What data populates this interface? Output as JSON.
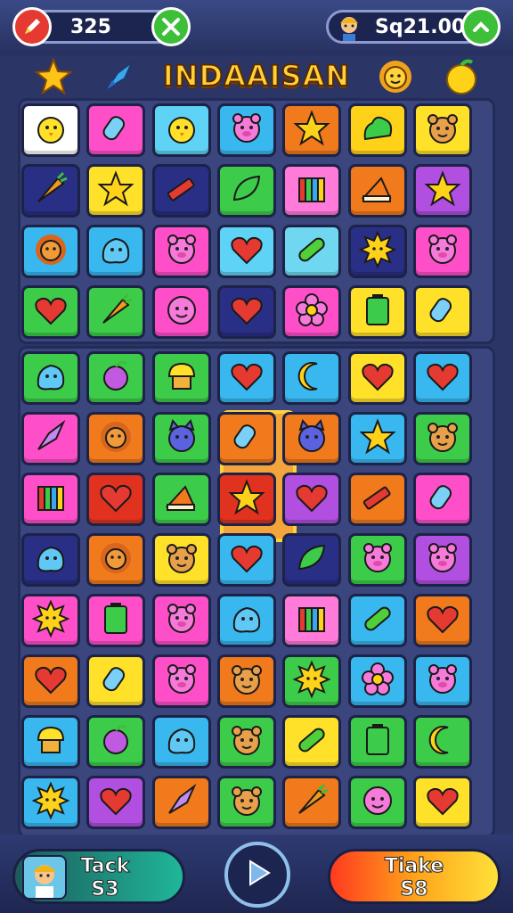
{
  "hud": {
    "score": "325",
    "currency": "Sq21.00",
    "score_icon": "pencil-icon",
    "tools_icon": "tools-icon",
    "up_icon": "chevron-up-icon",
    "avatar_icon": "character-avatar-icon"
  },
  "header": {
    "title": "INDAAISAN",
    "left_icons": [
      "star-icon",
      "rocket-icon"
    ],
    "right_icons": [
      "lion-icon",
      "fruit-icon"
    ]
  },
  "boards": [
    {
      "rows": [
        [
          [
            "#ffffff",
            "chick"
          ],
          [
            "#ff4fc8",
            "popsicle"
          ],
          [
            "#5fd3f5",
            "chick"
          ],
          [
            "#39b8ef",
            "pig"
          ],
          [
            "#f07a1c",
            "star"
          ],
          [
            "#ffd21a",
            "bush"
          ],
          [
            "#ffe12a",
            "bear"
          ]
        ],
        [
          [
            "#2a2f86",
            "carrot"
          ],
          [
            "#ffe12a",
            "star"
          ],
          [
            "#2a2f86",
            "crayon"
          ],
          [
            "#3dcc4a",
            "leaf"
          ],
          [
            "#ff7ad9",
            "books"
          ],
          [
            "#f07a1c",
            "cake"
          ],
          [
            "#b04fe0",
            "star"
          ]
        ],
        [
          [
            "#39b8ef",
            "lion"
          ],
          [
            "#39b8ef",
            "blob"
          ],
          [
            "#ff4fc8",
            "pig"
          ],
          [
            "#5fd3f5",
            "heart"
          ],
          [
            "#6fd8f0",
            "cucumber"
          ],
          [
            "#2a2f86",
            "sun"
          ],
          [
            "#ff4fc8",
            "pig"
          ]
        ],
        [
          [
            "#3dcc4a",
            "heart"
          ],
          [
            "#3dcc4a",
            "carrot"
          ],
          [
            "#ff4fc8",
            "smile"
          ],
          [
            "#2a2f86",
            "heart"
          ],
          [
            "#ff4fc8",
            "flower"
          ],
          [
            "#ffe12a",
            "battery"
          ],
          [
            "#ffe12a",
            "popsicle"
          ]
        ]
      ]
    },
    {
      "rows": [
        [
          [
            "#3dcc4a",
            "blob"
          ],
          [
            "#3dcc4a",
            "grape"
          ],
          [
            "#3dcc4a",
            "muffin"
          ],
          [
            "#39b8ef",
            "heart"
          ],
          [
            "#39b8ef",
            "crescent"
          ],
          [
            "#ffe12a",
            "heart"
          ],
          [
            "#39b8ef",
            "heart"
          ]
        ],
        [
          [
            "#ff4fc8",
            "rocket"
          ],
          [
            "#f07a1c",
            "lion"
          ],
          [
            "#3dcc4a",
            "cat"
          ],
          [
            "#f07a1c",
            "popsicle"
          ],
          [
            "#f07a1c",
            "cat"
          ],
          [
            "#39b8ef",
            "star"
          ],
          [
            "#3dcc4a",
            "bear"
          ]
        ],
        [
          [
            "#ff4fc8",
            "books"
          ],
          [
            "#e0321e",
            "heart"
          ],
          [
            "#3dcc4a",
            "cake"
          ],
          [
            "#e0321e",
            "star"
          ],
          [
            "#b04fe0",
            "heart"
          ],
          [
            "#f07a1c",
            "crayon"
          ],
          [
            "#ff4fc8",
            "popsicle"
          ]
        ],
        [
          [
            "#2a2f86",
            "blob"
          ],
          [
            "#f07a1c",
            "lion"
          ],
          [
            "#ffe12a",
            "bear"
          ],
          [
            "#39b8ef",
            "heart"
          ],
          [
            "#2a2f86",
            "leaf"
          ],
          [
            "#3dcc4a",
            "pig"
          ],
          [
            "#b04fe0",
            "pig"
          ]
        ],
        [
          [
            "#ff4fc8",
            "sun"
          ],
          [
            "#ff4fc8",
            "battery"
          ],
          [
            "#ff4fc8",
            "pig"
          ],
          [
            "#39b8ef",
            "blob"
          ],
          [
            "#ff7ad9",
            "books"
          ],
          [
            "#39b8ef",
            "cucumber"
          ],
          [
            "#f07a1c",
            "heart"
          ]
        ],
        [
          [
            "#f07a1c",
            "heart"
          ],
          [
            "#ffe12a",
            "popsicle"
          ],
          [
            "#ff4fc8",
            "pig"
          ],
          [
            "#f07a1c",
            "bear"
          ],
          [
            "#3dcc4a",
            "sun"
          ],
          [
            "#39b8ef",
            "flower"
          ],
          [
            "#39b8ef",
            "pig"
          ]
        ],
        [
          [
            "#39b8ef",
            "muffin"
          ],
          [
            "#3dcc4a",
            "grape"
          ],
          [
            "#39b8ef",
            "blob"
          ],
          [
            "#3dcc4a",
            "bear"
          ],
          [
            "#ffe12a",
            "cucumber"
          ],
          [
            "#3dcc4a",
            "battery"
          ],
          [
            "#3dcc4a",
            "crescent"
          ]
        ],
        [
          [
            "#39b8ef",
            "sun"
          ],
          [
            "#b04fe0",
            "heart"
          ],
          [
            "#f07a1c",
            "rocket"
          ],
          [
            "#3dcc4a",
            "bear"
          ],
          [
            "#f07a1c",
            "carrot"
          ],
          [
            "#3dcc4a",
            "smile"
          ],
          [
            "#ffe12a",
            "heart"
          ]
        ]
      ]
    }
  ],
  "footer": {
    "left_label": "Tack",
    "left_value": "S3",
    "right_label": "Tiake",
    "right_value": "S8",
    "play_icon": "play-icon",
    "avatar_icon": "character-avatar-icon"
  }
}
